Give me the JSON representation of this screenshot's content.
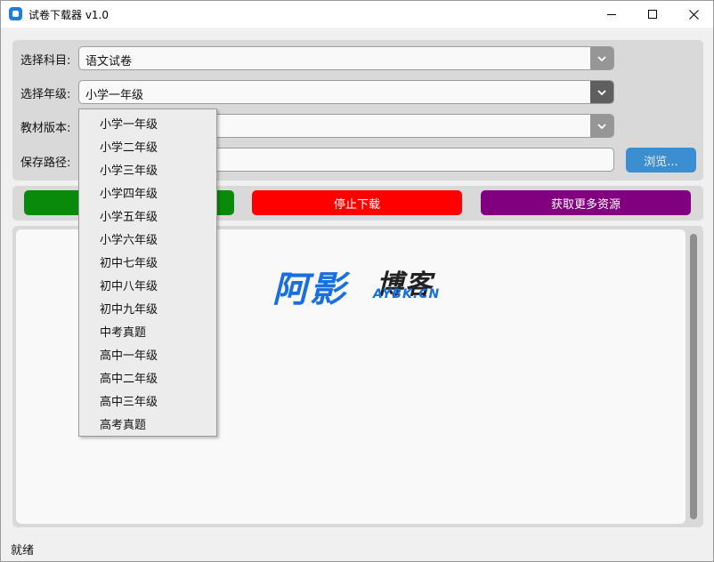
{
  "window": {
    "title": "试卷下载器 v1.0"
  },
  "form": {
    "subject_label": "选择科目:",
    "subject_value": "语文试卷",
    "grade_label": "选择年级:",
    "grade_value": "小学一年级",
    "edition_label": "教材版本:",
    "edition_value": "",
    "path_label": "保存路径:",
    "path_value": "",
    "browse_label": "浏览..."
  },
  "actions": {
    "start_label": "",
    "stop_label": "停止下载",
    "more_label": "获取更多资源"
  },
  "log": {
    "logo_main": "阿影",
    "logo_blog": "博客",
    "logo_domain": "AYBK.CN"
  },
  "dropdown": {
    "items": [
      "小学一年级",
      "小学二年级",
      "小学三年级",
      "小学四年级",
      "小学五年级",
      "小学六年级",
      "初中七年级",
      "初中八年级",
      "初中九年级",
      "中考真题",
      "高中一年级",
      "高中二年级",
      "高中三年级",
      "高考真题"
    ]
  },
  "status": {
    "text": "就绪"
  },
  "colors": {
    "start": "#0a8a0a",
    "stop": "#ff0000",
    "more": "#800080",
    "browse": "#3b8ed0",
    "logo_blue": "#1a6fe0"
  },
  "icons": {
    "app": "app-icon",
    "minimize": "minimize-icon",
    "maximize": "maximize-icon",
    "close": "close-icon",
    "dropdown": "chevron-down-icon"
  }
}
